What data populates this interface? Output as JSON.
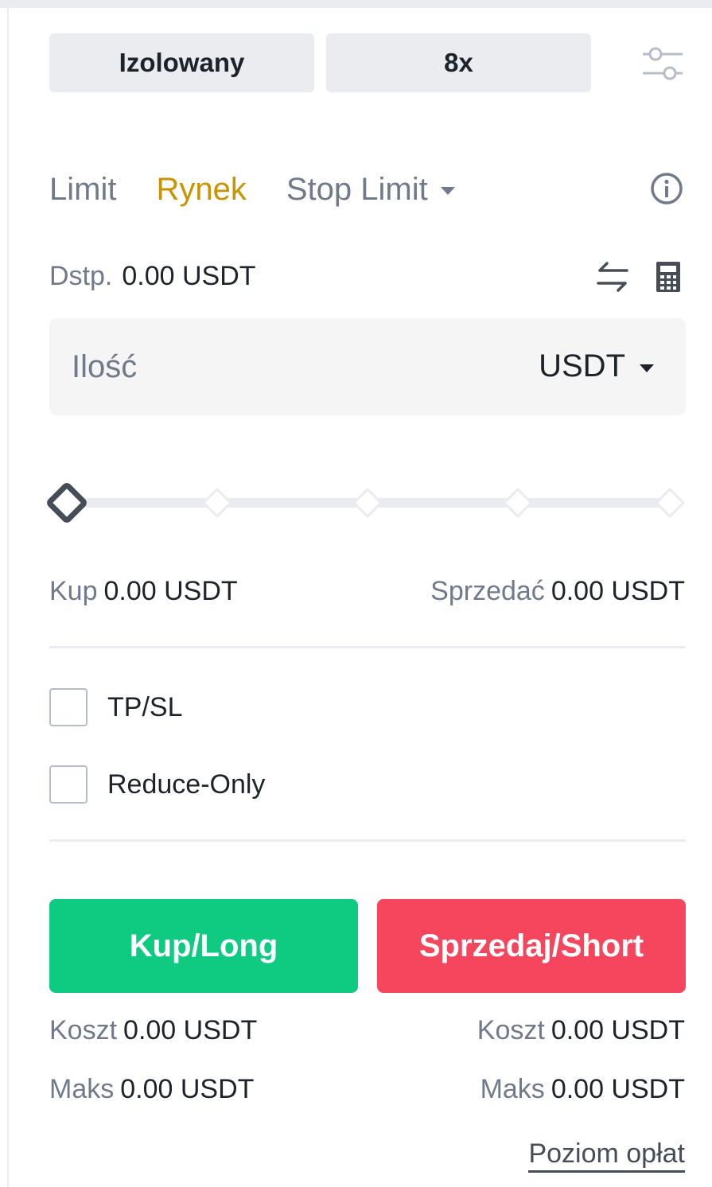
{
  "margin_mode": "Izolowany",
  "leverage": "8x",
  "tabs": [
    {
      "label": "Limit",
      "active": false
    },
    {
      "label": "Rynek",
      "active": true
    },
    {
      "label": "Stop Limit",
      "active": false
    }
  ],
  "available": {
    "label": "Dstp.",
    "value": "0.00 USDT"
  },
  "amount_input": {
    "placeholder": "Ilość",
    "value": "",
    "unit": "USDT"
  },
  "slider": {
    "percent": 0,
    "steps": 5
  },
  "buy_summary": {
    "label": "Kup",
    "value": "0.00 USDT"
  },
  "sell_summary": {
    "label": "Sprzedać",
    "value": "0.00 USDT"
  },
  "options": {
    "tpsl": "TP/SL",
    "reduce_only": "Reduce-Only"
  },
  "buy_button": "Kup/Long",
  "sell_button": "Sprzedaj/Short",
  "buy_cost": {
    "label": "Koszt",
    "value": "0.00 USDT"
  },
  "sell_cost": {
    "label": "Koszt",
    "value": "0.00 USDT"
  },
  "buy_max": {
    "label": "Maks",
    "value": "0.00 USDT"
  },
  "sell_max": {
    "label": "Maks",
    "value": "0.00 USDT"
  },
  "fee_link": "Poziom opłat",
  "colors": {
    "buy": "#0ecb81",
    "sell": "#f6465d",
    "active_tab": "#c99400",
    "muted": "#707a8a"
  },
  "icons": [
    "settings-sliders-icon",
    "info-icon",
    "swap-icon",
    "calculator-icon",
    "caret-down-icon"
  ]
}
